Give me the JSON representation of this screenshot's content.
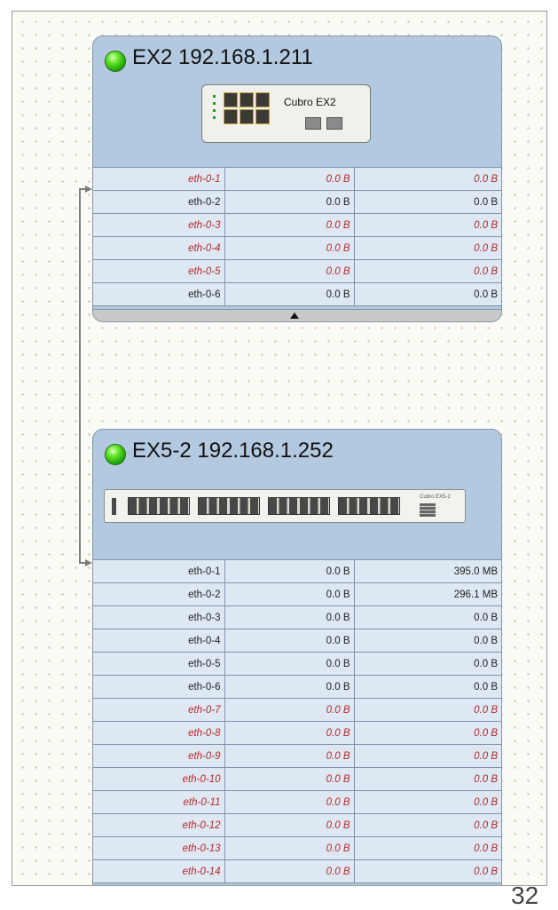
{
  "devices": [
    {
      "title": "EX2 192.168.1.211",
      "model_label": "Cubro EX2",
      "ports": [
        {
          "name": "eth-0-1",
          "rx": "0.0 B",
          "tx": "0.0 B",
          "state": "down"
        },
        {
          "name": "eth-0-2",
          "rx": "0.0 B",
          "tx": "0.0 B",
          "state": "up"
        },
        {
          "name": "eth-0-3",
          "rx": "0.0 B",
          "tx": "0.0 B",
          "state": "down"
        },
        {
          "name": "eth-0-4",
          "rx": "0.0 B",
          "tx": "0.0 B",
          "state": "down"
        },
        {
          "name": "eth-0-5",
          "rx": "0.0 B",
          "tx": "0.0 B",
          "state": "down"
        },
        {
          "name": "eth-0-6",
          "rx": "0.0 B",
          "tx": "0.0 B",
          "state": "up"
        }
      ]
    },
    {
      "title": "EX5-2 192.168.1.252",
      "model_label": "Cubro EX5-2",
      "ports": [
        {
          "name": "eth-0-1",
          "rx": "0.0 B",
          "tx": "395.0 MB",
          "state": "up"
        },
        {
          "name": "eth-0-2",
          "rx": "0.0 B",
          "tx": "296.1 MB",
          "state": "up"
        },
        {
          "name": "eth-0-3",
          "rx": "0.0 B",
          "tx": "0.0 B",
          "state": "up"
        },
        {
          "name": "eth-0-4",
          "rx": "0.0 B",
          "tx": "0.0 B",
          "state": "up"
        },
        {
          "name": "eth-0-5",
          "rx": "0.0 B",
          "tx": "0.0 B",
          "state": "up"
        },
        {
          "name": "eth-0-6",
          "rx": "0.0 B",
          "tx": "0.0 B",
          "state": "up"
        },
        {
          "name": "eth-0-7",
          "rx": "0.0 B",
          "tx": "0.0 B",
          "state": "down"
        },
        {
          "name": "eth-0-8",
          "rx": "0.0 B",
          "tx": "0.0 B",
          "state": "down"
        },
        {
          "name": "eth-0-9",
          "rx": "0.0 B",
          "tx": "0.0 B",
          "state": "down"
        },
        {
          "name": "eth-0-10",
          "rx": "0.0 B",
          "tx": "0.0 B",
          "state": "down"
        },
        {
          "name": "eth-0-11",
          "rx": "0.0 B",
          "tx": "0.0 B",
          "state": "down"
        },
        {
          "name": "eth-0-12",
          "rx": "0.0 B",
          "tx": "0.0 B",
          "state": "down"
        },
        {
          "name": "eth-0-13",
          "rx": "0.0 B",
          "tx": "0.0 B",
          "state": "down"
        },
        {
          "name": "eth-0-14",
          "rx": "0.0 B",
          "tx": "0.0 B",
          "state": "down"
        }
      ]
    }
  ],
  "page_number": "32",
  "colors": {
    "status_up": "#3cc81e",
    "port_down_text": "#b42a2a",
    "header_bg": "#b3c9e0",
    "row_bg": "#dde8f3"
  }
}
